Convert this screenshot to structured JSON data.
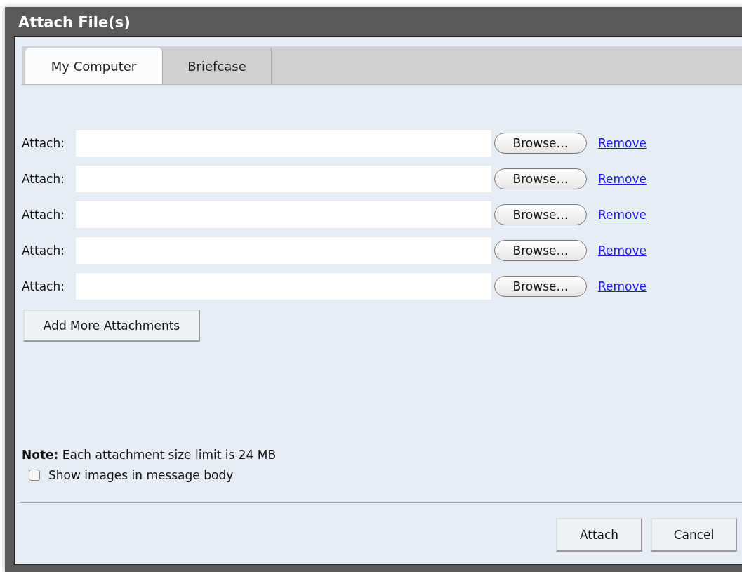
{
  "window": {
    "title": "Attach File(s)"
  },
  "tabs": [
    {
      "label": "My Computer",
      "selected": true
    },
    {
      "label": "Briefcase",
      "selected": false
    }
  ],
  "attachments": [
    {
      "label": "Attach:",
      "browse": "Browse…",
      "remove": "Remove"
    },
    {
      "label": "Attach:",
      "browse": "Browse…",
      "remove": "Remove"
    },
    {
      "label": "Attach:",
      "browse": "Browse…",
      "remove": "Remove"
    },
    {
      "label": "Attach:",
      "browse": "Browse…",
      "remove": "Remove"
    },
    {
      "label": "Attach:",
      "browse": "Browse…",
      "remove": "Remove"
    }
  ],
  "add_more_button": "Add More Attachments",
  "note": "**Note:** Each attachment size limit is 24 MB",
  "show_images": {
    "label": "Show images in message body",
    "checked": false
  },
  "buttons": [
    "Attach",
    "Cancel"
  ]
}
